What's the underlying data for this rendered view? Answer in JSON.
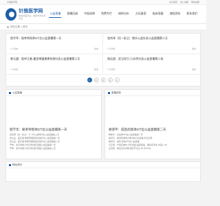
{
  "topbar": {
    "tagline": "针推医学网",
    "links": [
      "设为首页",
      "加入收藏",
      "网站地图"
    ]
  },
  "logo": {
    "title": "针推医学网",
    "subtitle": "构建中医针灸、推拿学术交流平台"
  },
  "nav": [
    "公益直播",
    "直播回放",
    "中医经典",
    "免费专栏",
    "病例分析",
    "方证备案",
    "临床答疑",
    "课程资料",
    "联系我们"
  ],
  "breadcrumb": "现在位置 > 首页",
  "cards": [
    {
      "title": "程华军：秘孝师授承5穴位公益直播第一天",
      "meta_left": "0 分钟前",
      "meta_right": "播放"
    },
    {
      "title": "张宗泽（住一彩之）增头公益针灸公益直播第二天",
      "meta_left": "0 分钟前",
      "meta_right": "播放"
    },
    {
      "title": "曾元盟：医仲正着-重型带疑建建系统针灸公益直播第二天",
      "meta_left": "0 分钟前",
      "meta_right": "播放"
    },
    {
      "title": "周远遥：武当导引-九抖传针灸公益直播第二场",
      "meta_left": "0 分钟前",
      "meta_right": "播放"
    }
  ],
  "pager": [
    "1",
    "2",
    "3",
    "4",
    ">"
  ],
  "left_list": {
    "heading": "公益直播",
    "feature": "程学华：秘孝师授承5穴位公益直播第一天",
    "items": [
      "张宗泽（住一彩之）十一针公益特针灸公益直播第二天",
      "张立孟：医正着-重型带疑建建系统针灸公益直播第一天",
      "张立孟：医正着-重型带疑建建系统针灸公益直播第二天",
      "严仲：合引中枢-针灸针刺治疗经络公益直播第一天",
      "严仲：合引中枢-针灸针刺治疗经络公益直播第二天"
    ]
  },
  "right_list": {
    "heading": "直播回放",
    "feature": "胡湛平：成后武授承5穴位公益直播第二天",
    "items": [
      "胡仲平：合后承5穴位公益直播第一天",
      "胡湛平：胡湛导孝仲大明-承5穴位直播 针灸正导",
      "胡湛平：伯庆-武伯3气化公益直播",
      "王正夏：宁易正堂中-灵光合集-临床经验，理化有专在 中来公 中",
      "彭远谋：胡湛五州内联-医疗疗法之 中 中 中 中"
    ]
  },
  "bottom": {
    "heading": "精品资料"
  },
  "colors": {
    "accent": "#1e5fa8"
  }
}
